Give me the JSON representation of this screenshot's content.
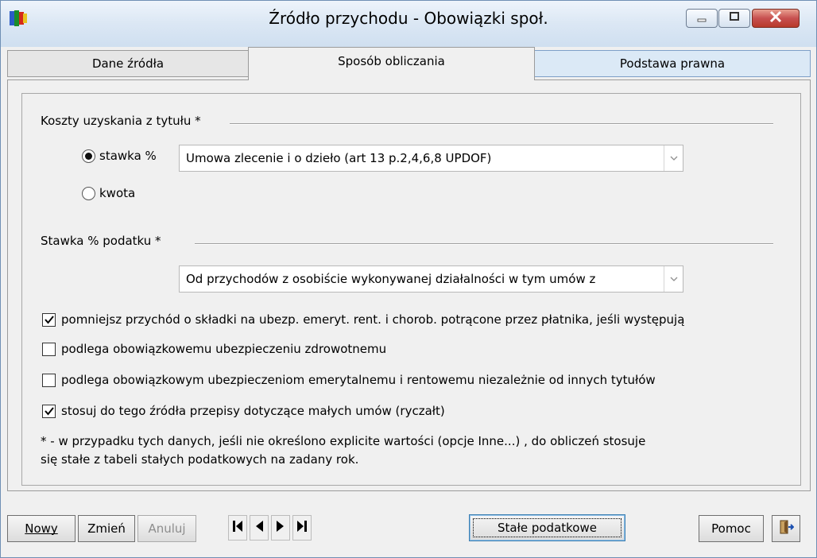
{
  "window": {
    "title": "Źródło przychodu - Obowiązki społ.",
    "icons": {
      "app": "app-logo-icon",
      "minimize": "minimize-icon",
      "maximize": "maximize-icon",
      "close": "close-icon"
    }
  },
  "tabs": [
    {
      "label": "Dane źródła",
      "active": false
    },
    {
      "label": "Sposób obliczania",
      "active": true
    },
    {
      "label": "Podstawa prawna",
      "active": false
    }
  ],
  "costs": {
    "section_label": "Koszty uzyskania z tytułu *",
    "radio_rate_label": "stawka %",
    "radio_amount_label": "kwota",
    "selected": "stawka %",
    "combo_value": "Umowa zlecenie i o dzieło (art 13 p.2,4,6,8 UPDOF)"
  },
  "tax": {
    "section_label": "Stawka % podatku *",
    "combo_value": "Od przychodów z osobiście wykonywanej działalności w tym umów z"
  },
  "options": [
    {
      "label": "pomniejsz przychód o składki na ubezp. emeryt. rent. i chorob. potrącone przez płatnika, jeśli występują",
      "checked": true
    },
    {
      "label": "podlega obowiązkowemu ubezpieczeniu zdrowotnemu",
      "checked": false
    },
    {
      "label": "podlega obowiązkowym ubezpieczeniom emerytalnemu i rentowemu niezależnie od innych tytułów",
      "checked": false
    },
    {
      "label": "stosuj do tego źródła  przepisy dotyczące małych umów (ryczałt)",
      "checked": true
    }
  ],
  "note": {
    "line1": "* - w przypadku tych danych, jeśli nie określono explicite wartości (opcje Inne...) , do obliczeń stosuje",
    "line2": "się stałe z tabeli stałych podatkowych na zadany rok."
  },
  "buttons": {
    "new": "Nowy",
    "edit": "Zmień",
    "cancel": "Anuluj",
    "tax_constants": "Stałe podatkowe",
    "help": "Pomoc"
  },
  "nav_icons": [
    "first-record-icon",
    "prev-record-icon",
    "next-record-icon",
    "last-record-icon"
  ],
  "exit_icon": "exit-door-icon"
}
